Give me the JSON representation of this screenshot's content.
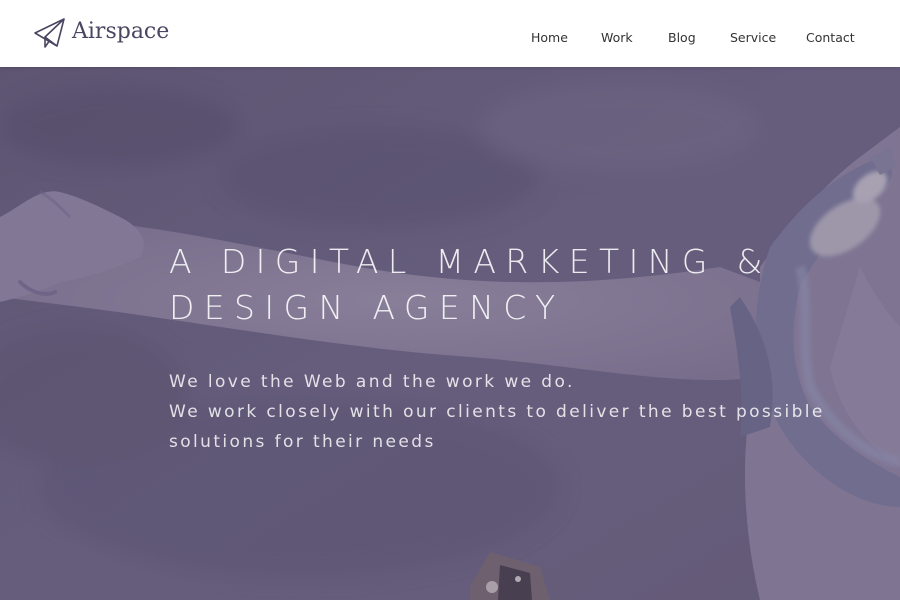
{
  "brand": {
    "name": "Airspace",
    "logo_icon": "paper-plane-icon",
    "text_color": "#4a4560"
  },
  "nav": {
    "items": [
      {
        "label": "Home"
      },
      {
        "label": "Work"
      },
      {
        "label": "Blog"
      },
      {
        "label": "Service"
      },
      {
        "label": "Contact"
      }
    ]
  },
  "hero": {
    "title": "A DIGITAL MARKETING & DESIGN AGENCY",
    "lines": [
      "We love the Web and the work we do.",
      "We work closely with our clients to deliver the best possible solutions for their needs"
    ],
    "overlay_color": "#5c5278"
  }
}
